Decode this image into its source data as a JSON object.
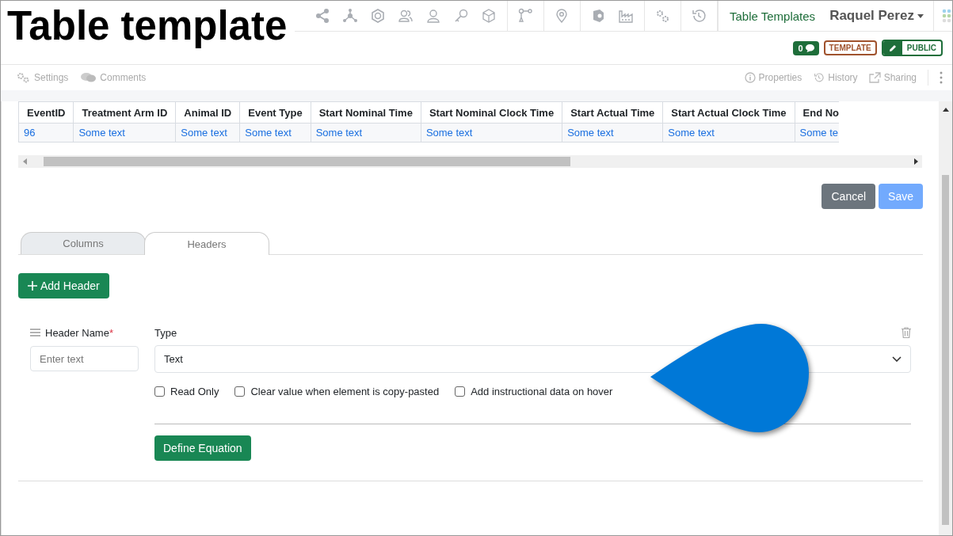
{
  "page_title": "Table template",
  "nav": {
    "link": "Table Templates",
    "user": "Raquel Perez"
  },
  "badges": {
    "comments": "0",
    "template": "TEMPLATE",
    "visibility": "PUBLIC"
  },
  "actions_left": [
    "Settings",
    "Comments"
  ],
  "actions_right": [
    "Properties",
    "History",
    "Sharing"
  ],
  "table": {
    "columns": [
      "EventID",
      "Treatment Arm ID",
      "Animal ID",
      "Event Type",
      "Start Nominal Time",
      "Start Nominal Clock Time",
      "Start Actual Time",
      "Start Actual Clock Time",
      "End No"
    ],
    "rows": [
      [
        "96",
        "Some text",
        "Some text",
        "Some text",
        "Some text",
        "Some text",
        "Some text",
        "Some text",
        "Some te"
      ]
    ]
  },
  "buttons": [
    {
      "label": "Cancel",
      "kind": "secondary",
      "disabled": false
    },
    {
      "label": "Save",
      "kind": "primary",
      "disabled": true
    }
  ],
  "tabs": [
    {
      "label": "Columns",
      "selected": false
    },
    {
      "label": "Headers",
      "selected": true
    }
  ],
  "add_header": "Add Header",
  "header_editor": {
    "name_label": "Header Name",
    "required_mark": "*",
    "name_placeholder": "Enter text",
    "type_label": "Type",
    "type_value": "Text",
    "options": [
      {
        "label": "Read Only",
        "checked": false
      },
      {
        "label": "Clear value when element is copy-pasted",
        "checked": false
      },
      {
        "label": "Add instructional data on hover",
        "checked": false
      }
    ],
    "equation_button": "Define Equation"
  }
}
